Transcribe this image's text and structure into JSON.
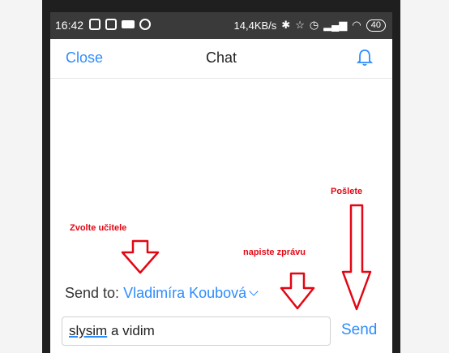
{
  "status_bar": {
    "time": "16:42",
    "network_speed": "14,4KB/s",
    "battery": "40",
    "icons": [
      "teamviewer-icon",
      "teamviewer-icon",
      "video-icon",
      "app-icon",
      "bluetooth-icon",
      "nfc-icon",
      "alarm-icon",
      "signal-icon",
      "wifi-icon"
    ]
  },
  "nav": {
    "close_label": "Close",
    "title": "Chat",
    "bell_icon": "bell-icon"
  },
  "annotations": {
    "choose_teacher": "Zvolte učitele",
    "write_message": "napiste zprávu",
    "send": "Pošlete"
  },
  "send_to": {
    "label": "Send to:",
    "recipient": "Vladimíra Koubová"
  },
  "composer": {
    "input_value_word1": "slysim",
    "input_value_rest": " a vidim",
    "send_label": "Send"
  },
  "colors": {
    "accent": "#2d8cff",
    "annotation": "#e30613"
  }
}
